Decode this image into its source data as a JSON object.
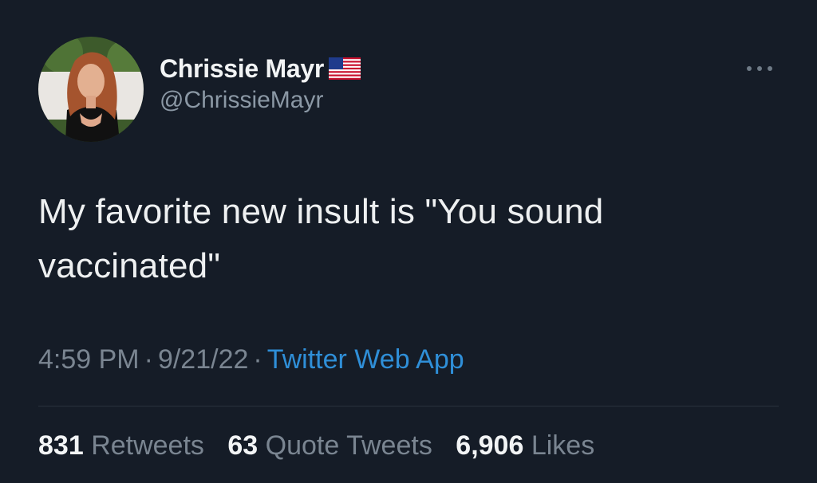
{
  "author": {
    "display_name": "Chrissie Mayr",
    "handle": "@ChrissieMayr",
    "badge_icon": "us-flag-icon"
  },
  "tweet": {
    "text": "My favorite new insult is \"You sound vaccinated\""
  },
  "meta": {
    "time": "4:59 PM",
    "date": "9/21/22",
    "separator": "·",
    "source": "Twitter Web App"
  },
  "stats": {
    "retweets": {
      "count": "831",
      "label": "Retweets"
    },
    "quote_tweets": {
      "count": "63",
      "label": "Quote Tweets"
    },
    "likes": {
      "count": "6,906",
      "label": "Likes"
    }
  },
  "icons": {
    "more": "more-options-icon"
  },
  "colors": {
    "background": "#151c27",
    "link": "#2f8fd8",
    "muted": "#7a8591"
  }
}
